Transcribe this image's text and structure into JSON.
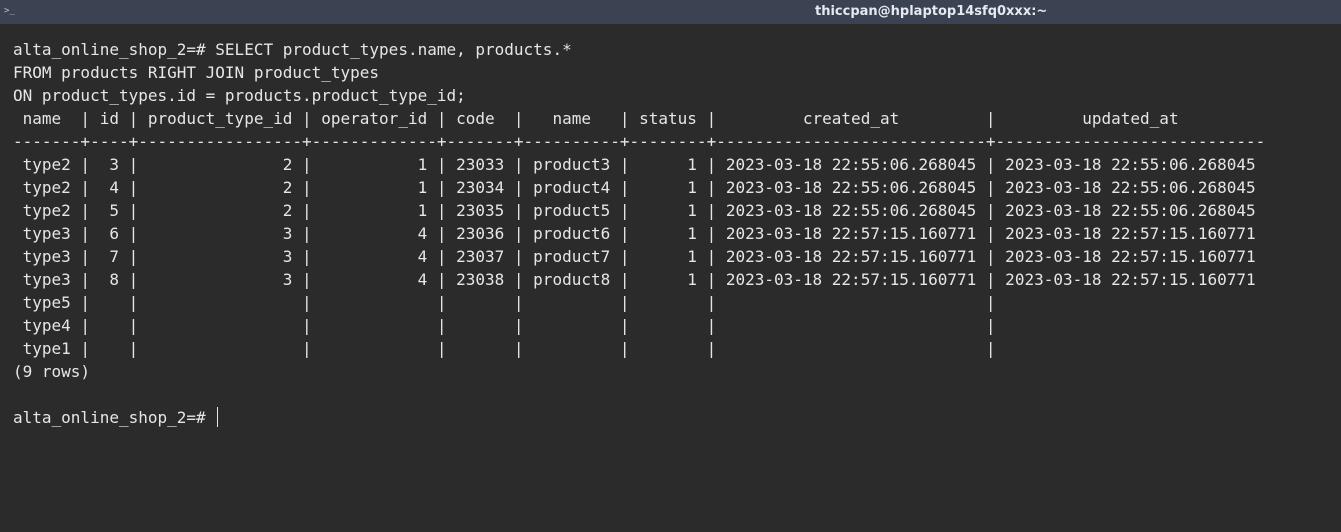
{
  "window": {
    "title": "thiccpan@hplaptop14sfq0xxx:~",
    "icon": "terminal-icon"
  },
  "terminal": {
    "query_lines": [
      "alta_online_shop_2=# SELECT product_types.name, products.*",
      "FROM products RIGHT JOIN product_types",
      "ON product_types.id = products.product_type_id;"
    ],
    "table": {
      "header": " name  | id | product_type_id | operator_id | code  |   name   | status |         created_at         |         updated_at",
      "separator": "-------+----+-----------------+-------------+-------+----------+--------+----------------------------+----------------------------",
      "rows": [
        " type2 |  3 |               2 |           1 | 23033 | product3 |      1 | 2023-03-18 22:55:06.268045 | 2023-03-18 22:55:06.268045",
        " type2 |  4 |               2 |           1 | 23034 | product4 |      1 | 2023-03-18 22:55:06.268045 | 2023-03-18 22:55:06.268045",
        " type2 |  5 |               2 |           1 | 23035 | product5 |      1 | 2023-03-18 22:55:06.268045 | 2023-03-18 22:55:06.268045",
        " type3 |  6 |               3 |           4 | 23036 | product6 |      1 | 2023-03-18 22:57:15.160771 | 2023-03-18 22:57:15.160771",
        " type3 |  7 |               3 |           4 | 23037 | product7 |      1 | 2023-03-18 22:57:15.160771 | 2023-03-18 22:57:15.160771",
        " type3 |  8 |               3 |           4 | 23038 | product8 |      1 | 2023-03-18 22:57:15.160771 | 2023-03-18 22:57:15.160771",
        " type5 |    |                 |             |       |          |        |                            |",
        " type4 |    |                 |             |       |          |        |                            |",
        " type1 |    |                 |             |       |          |        |                            |"
      ],
      "footer": "(9 rows)"
    },
    "prompt": "alta_online_shop_2=# "
  },
  "colors": {
    "background": "#2b2b2b",
    "titlebar": "#3b4252",
    "text": "#e6e6e6"
  }
}
